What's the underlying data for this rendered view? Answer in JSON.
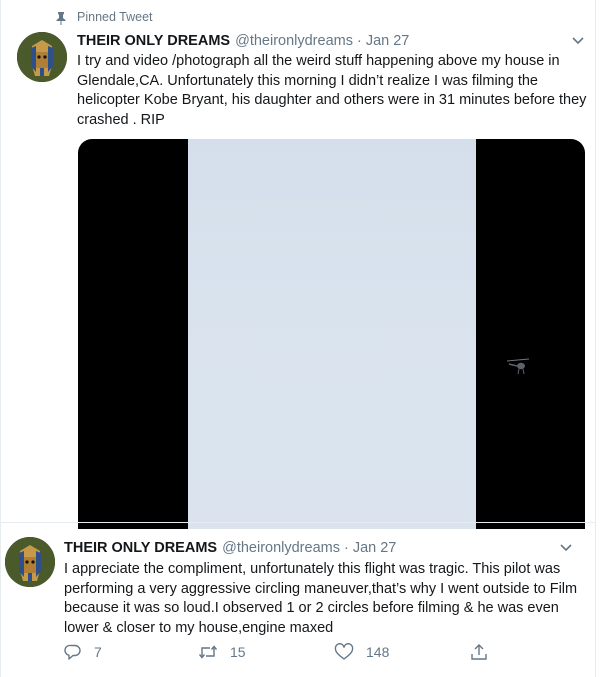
{
  "pinned_label": "Pinned Tweet",
  "tweet1": {
    "name": "THEIR ONLY DREAMS",
    "handle": "@theironlydreams",
    "separator": "·",
    "date": "Jan 27",
    "text": "I try and video /photograph all the weird stuff happening above my house in Glendale,CA. Unfortunately this morning I didn’t realize I was filming the helicopter Kobe Bryant, his daughter and others were in 31 minutes before they crashed . RIP"
  },
  "tweet2": {
    "name": "THEIR ONLY DREAMS",
    "handle": "@theironlydreams",
    "separator": "·",
    "date": "Jan 27",
    "text": "I appreciate the compliment, unfortunately this flight was tragic. This pilot was performing a very aggressive circling maneuver,that’s why I went outside to Film because it was so loud.I observed 1 or 2 circles before filming & he was even lower & closer to my house,engine maxed",
    "actions": {
      "replies": "7",
      "retweets": "15",
      "likes": "148"
    }
  },
  "icons": {
    "pin": "pin-icon",
    "chevron": "chevron-down-icon",
    "reply": "reply-icon",
    "retweet": "retweet-icon",
    "like": "heart-icon",
    "share": "share-icon"
  },
  "colors": {
    "secondary_text": "#657786",
    "primary_text": "#14171a",
    "border": "#e6ecf0"
  }
}
